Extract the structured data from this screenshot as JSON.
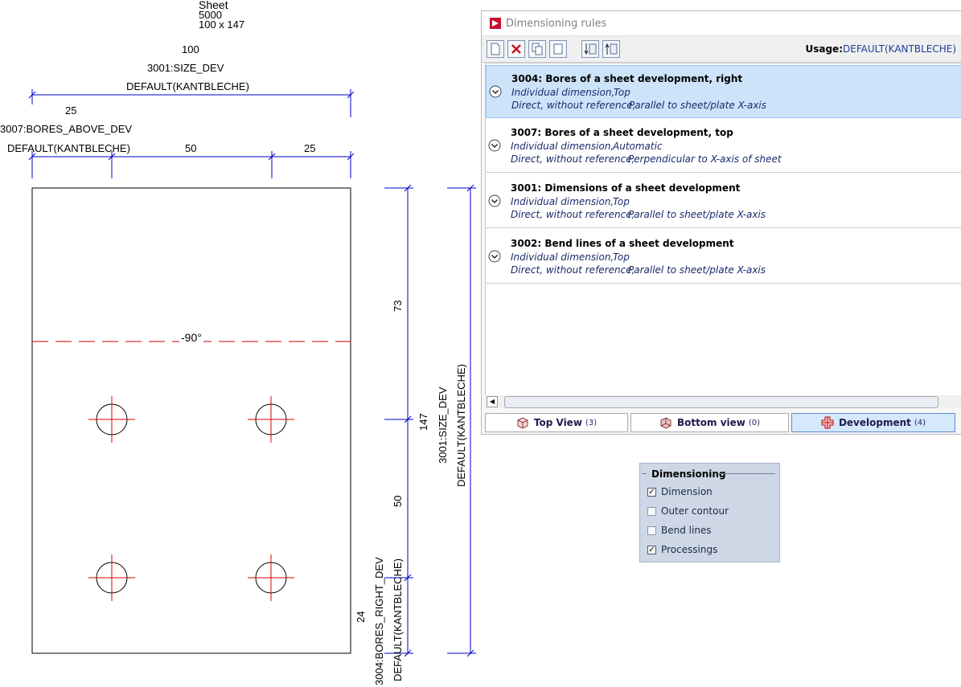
{
  "drawing": {
    "sheet_title": "Sheet",
    "sheet_material": "5000",
    "sheet_size": "100 x 147",
    "top_dim": {
      "value": "100",
      "rule": "3001:SIZE_DEV",
      "usage": "DEFAULT(KANTBLECHE)"
    },
    "bores_above": {
      "value_left": "25",
      "rule": "3007:BORES_ABOVE_DEV",
      "usage": "DEFAULT(KANTBLECHE)",
      "value_mid": "50",
      "value_right": "25"
    },
    "bend_label": "-90°",
    "right_dim": {
      "v1": "73",
      "v2": "50",
      "v3": "24",
      "rule": "3004:BORES_RIGHT_DEV",
      "usage": "DEFAULT(KANTBLECHE)"
    },
    "size_dim": {
      "value": "147",
      "rule": "3001:SIZE_DEV",
      "usage": "DEFAULT(KANTBLECHE)"
    }
  },
  "dialog": {
    "title": "Dimensioning rules",
    "toolbar_icons": [
      "new-icon",
      "delete-icon",
      "copy-icon",
      "paste-icon",
      "move-down-icon",
      "move-up-icon"
    ],
    "usage_label": "Usage:",
    "usage_value": "DEFAULT(KANTBLECHE)",
    "rules": [
      {
        "title": "3004: Bores of a sheet development, right",
        "type": "Individual dimension,",
        "position": "Top",
        "reference": "Direct, without reference,",
        "orientation": "Parallel to sheet/plate X-axis",
        "selected": true
      },
      {
        "title": "3007: Bores of a sheet development, top",
        "type": "Individual dimension,",
        "position": "Automatic",
        "reference": "Direct, without reference,",
        "orientation": "Perpendicular to X-axis of sheet",
        "selected": false
      },
      {
        "title": "3001: Dimensions of a sheet development",
        "type": "Individual dimension,",
        "position": "Top",
        "reference": "Direct, without reference,",
        "orientation": "Parallel to sheet/plate X-axis",
        "selected": false
      },
      {
        "title": "3002: Bend lines of a sheet development",
        "type": "Individual dimension,",
        "position": "Top",
        "reference": "Direct, without reference,",
        "orientation": "Parallel to sheet/plate X-axis",
        "selected": false
      }
    ],
    "tabs": [
      {
        "label": "Top View",
        "count": "(3)",
        "active": false
      },
      {
        "label": "Bottom view",
        "count": "(0)",
        "active": false
      },
      {
        "label": "Development",
        "count": "(4)",
        "active": true
      }
    ]
  },
  "panel": {
    "title": "Dimensioning",
    "options": [
      {
        "label": "Dimension",
        "checked": true
      },
      {
        "label": "Outer contour",
        "checked": false
      },
      {
        "label": "Bend lines",
        "checked": false
      },
      {
        "label": "Processings",
        "checked": true
      }
    ]
  },
  "colors": {
    "dimension": "#0000cc",
    "bend_line": "#cc0000",
    "hole_marker": "#e00000",
    "selected_row": "#cde3fa"
  }
}
